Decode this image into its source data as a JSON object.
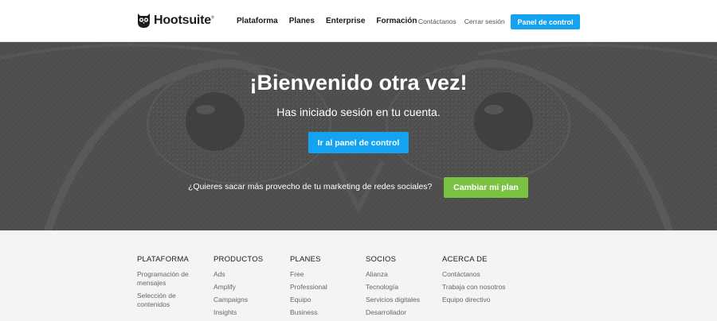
{
  "header": {
    "logo_text": "Hootsuite",
    "logo_reg": "®",
    "nav_main": [
      "Plataforma",
      "Planes",
      "Enterprise",
      "Formación"
    ],
    "nav_secondary": [
      "Contáctanos",
      "Cerrar sesión"
    ],
    "panel_button": "Panel de control"
  },
  "hero": {
    "title": "¡Bienvenido otra vez!",
    "subtitle": "Has iniciado sesión en tu cuenta.",
    "panel_button": "Ir al panel de control",
    "question": "¿Quieres sacar más provecho de tu marketing de redes sociales?",
    "plan_button": "Cambiar mi plan"
  },
  "footer": {
    "columns": [
      {
        "heading": "PLATAFORMA",
        "links": [
          "Programación de mensajes",
          "Selección de contenidos"
        ]
      },
      {
        "heading": "PRODUCTOS",
        "links": [
          "Ads",
          "Amplify",
          "Campaigns",
          "Insights"
        ]
      },
      {
        "heading": "PLANES",
        "links": [
          "Free",
          "Professional",
          "Equipo",
          "Business"
        ]
      },
      {
        "heading": "SOCIOS",
        "links": [
          "Alianza",
          "Tecnología",
          "Servicios digitales",
          "Desarrollador"
        ]
      },
      {
        "heading": "ACERCA DE",
        "links": [
          "Contáctanos",
          "Trabaja con nosotros",
          "Equipo directivo"
        ]
      }
    ]
  },
  "colors": {
    "accent_blue": "#13a3f0",
    "accent_green": "#7cc242",
    "hero_bg": "#4f4f4f"
  },
  "icons": {
    "logo": "owl-logo-icon"
  }
}
